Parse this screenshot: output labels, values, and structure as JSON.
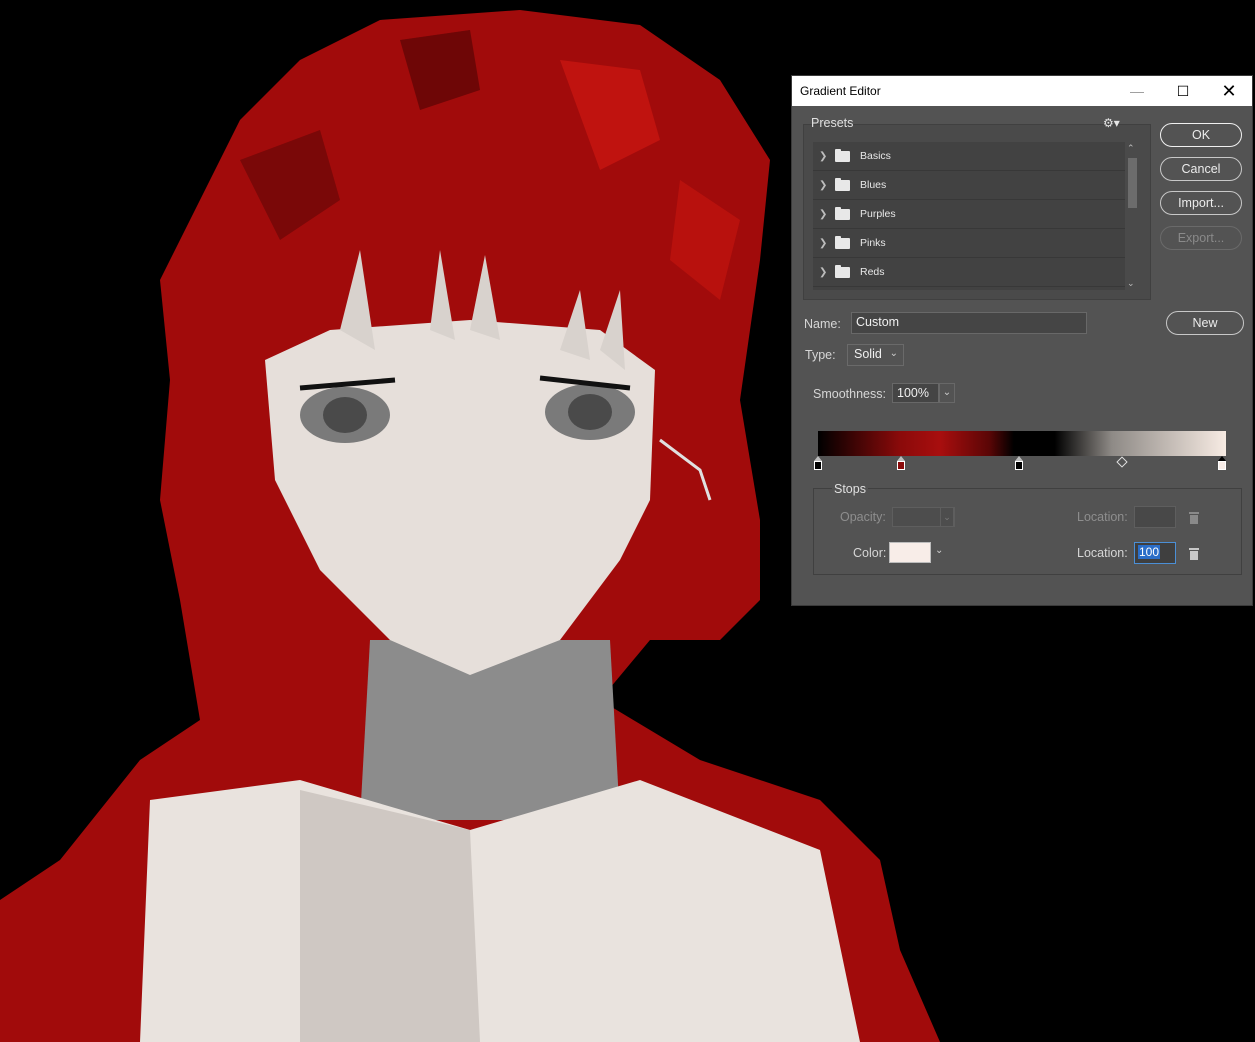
{
  "dialog": {
    "title": "Gradient Editor",
    "window_controls": {
      "minimize": "—",
      "maximize": "☐",
      "close": "✕"
    },
    "presets": {
      "label": "Presets",
      "gear_icon": "⚙▾",
      "items": [
        {
          "label": "Basics"
        },
        {
          "label": "Blues"
        },
        {
          "label": "Purples"
        },
        {
          "label": "Pinks"
        },
        {
          "label": "Reds"
        }
      ]
    },
    "buttons": {
      "ok": "OK",
      "cancel": "Cancel",
      "import": "Import...",
      "export": "Export...",
      "new": "New"
    },
    "name": {
      "label": "Name:",
      "value": "Custom"
    },
    "type": {
      "label": "Type:",
      "value": "Solid"
    },
    "smoothness": {
      "label": "Smoothness:",
      "value": "100%"
    },
    "gradient": {
      "colors": [
        "#000000",
        "#8a0a0a",
        "#a80e0e",
        "#5a0606",
        "#000000",
        "#8e8a86",
        "#f7ebe3"
      ],
      "color_stops": [
        {
          "location": 0,
          "color": "#000000"
        },
        {
          "location": 20,
          "color": "#8a0a0a"
        },
        {
          "location": 49,
          "color": "#000000"
        },
        {
          "location": 100,
          "color": "#f7ebe3",
          "selected": true
        }
      ],
      "midpoint_location": 75
    },
    "stops": {
      "label": "Stops",
      "opacity_label": "Opacity:",
      "opacity_location_label": "Location:",
      "color_label": "Color:",
      "color_location_label": "Location:",
      "color_location_value": "100",
      "selected_color": "#f8ede8"
    }
  },
  "canvas": {
    "accent_color": "#a10b0b",
    "skin_color": "#eee7e1",
    "background_color": "#000000"
  }
}
